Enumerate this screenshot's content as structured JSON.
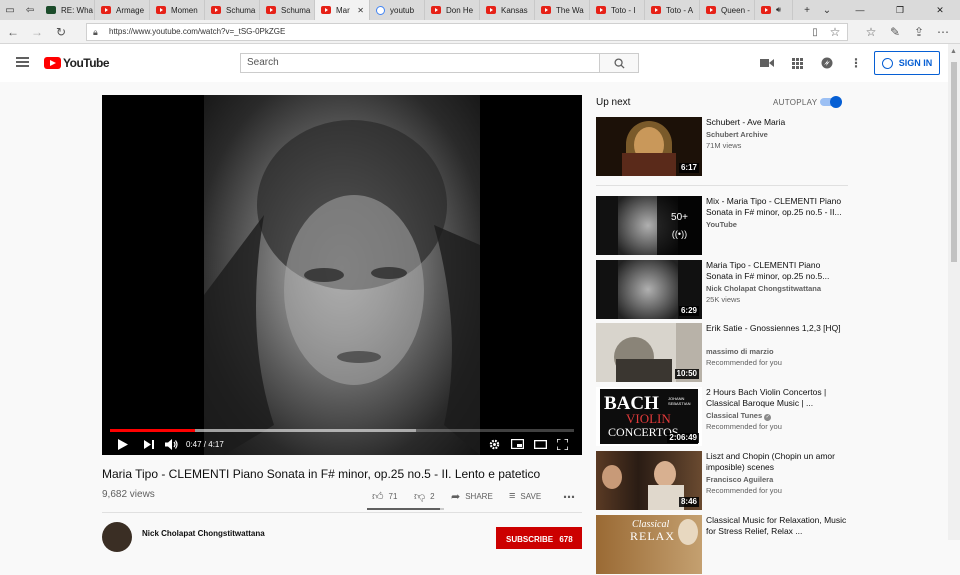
{
  "browser": {
    "tabs": [
      {
        "label": "RE: Wha",
        "icon": "dark"
      },
      {
        "label": "Armage",
        "icon": "yt"
      },
      {
        "label": "Momen",
        "icon": "yt"
      },
      {
        "label": "Schuma",
        "icon": "yt"
      },
      {
        "label": "Schuma",
        "icon": "yt"
      },
      {
        "label": "Mar",
        "icon": "yt",
        "active": true
      },
      {
        "label": "youtub",
        "icon": "google"
      },
      {
        "label": "Don He",
        "icon": "yt"
      },
      {
        "label": "Kansas",
        "icon": "yt"
      },
      {
        "label": "The Wa",
        "icon": "yt"
      },
      {
        "label": "Toto - I",
        "icon": "yt"
      },
      {
        "label": "Toto - A",
        "icon": "yt"
      },
      {
        "label": "Queen -",
        "icon": "yt"
      },
      {
        "label": "",
        "icon": "yt"
      }
    ],
    "new_tab": "+",
    "url": "https://www.youtube.com/watch?v=_tSG-0PkZGE"
  },
  "header": {
    "logo_text": "YouTube",
    "search_placeholder": "Search",
    "signin_label": "SIGN IN"
  },
  "player": {
    "time": "0:47 / 4:17",
    "played_fraction": 0.183,
    "loaded_fraction": 0.66
  },
  "video": {
    "title": "Maria Tipo - CLEMENTI Piano Sonata in F# minor, op.25 no.5 - II. Lento e patetico",
    "views": "9,682 views",
    "likes": "71",
    "dislikes": "2",
    "share_label": "SHARE",
    "save_label": "SAVE",
    "owner": "Nick Cholapat Chongstitwattana",
    "subscribe_label": "SUBSCRIBE",
    "subscriber_count": "678"
  },
  "upnext": {
    "heading": "Up next",
    "autoplay_label": "AUTOPLAY",
    "autoplay_on": true
  },
  "recommendations": [
    {
      "title": "Schubert - Ave Maria",
      "channel": "Schubert Archive",
      "meta": "71M views",
      "duration": "6:17",
      "thumb": "madonna"
    },
    {
      "title": "Mix - Maria Tipo - CLEMENTI Piano Sonata in F# minor, op.25 no.5 - II...",
      "channel": "YouTube",
      "meta": "",
      "duration": "",
      "mix_count": "50+",
      "thumb": "portrait"
    },
    {
      "title": "Maria Tipo - CLEMENTI Piano Sonata in F# minor, op.25 no.5...",
      "channel": "Nick Cholapat Chongstitwattana",
      "meta": "25K views",
      "duration": "6:29",
      "thumb": "portrait"
    },
    {
      "title": "Erik Satie - Gnossiennes 1,2,3 [HQ]",
      "channel": "massimo di marzio",
      "meta": "Recommended for you",
      "duration": "10:50",
      "thumb": "satie"
    },
    {
      "title": "2 Hours Bach Violin Concertos | Classical Baroque Music | ...",
      "channel": "Classical Tunes",
      "verified": true,
      "meta": "Recommended for you",
      "duration": "2:06:49",
      "thumb": "bach",
      "thumb_text": [
        "BACH",
        "JOHANN SEBASTIAN",
        "VIOLIN",
        "CONCERTOS"
      ]
    },
    {
      "title": "Liszt and Chopin (Chopin un amor imposible) scenes",
      "channel": "Francisco Aguilera",
      "meta": "Recommended for you",
      "duration": "8:46",
      "thumb": "film"
    },
    {
      "title": "Classical Music for Relaxation, Music for Stress Relief, Relax ...",
      "channel": "",
      "meta": "",
      "duration": "",
      "thumb": "relax",
      "thumb_text": [
        "Classical",
        "RELAX"
      ]
    }
  ]
}
